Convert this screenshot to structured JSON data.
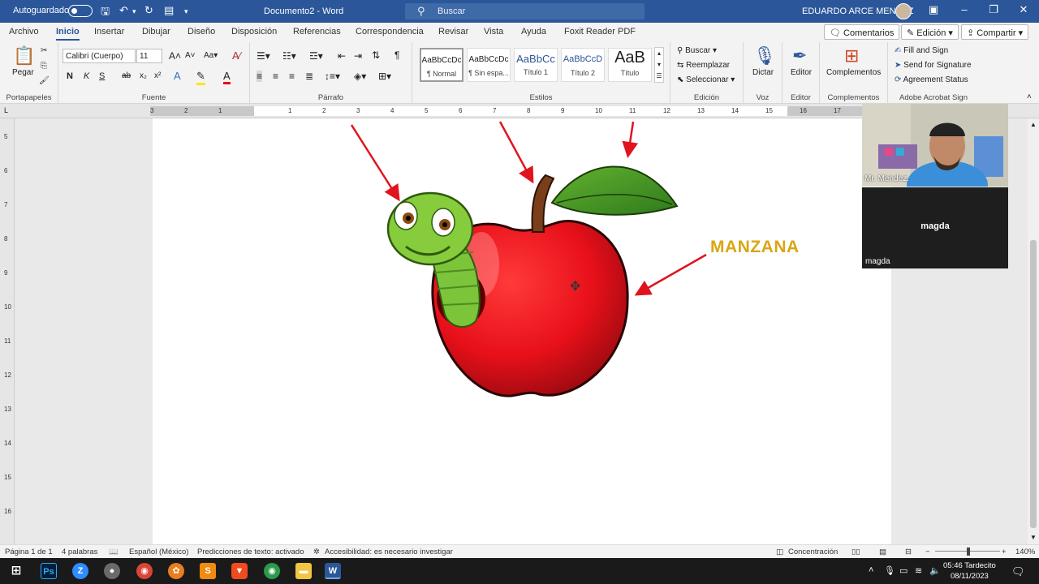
{
  "titlebar": {
    "autosave_label": "Autoguardado",
    "doc_title": "Documento2 - Word",
    "search_placeholder": "Buscar",
    "user_name": "EDUARDO ARCE MENDEZ"
  },
  "tabs": [
    "Archivo",
    "Inicio",
    "Insertar",
    "Dibujar",
    "Diseño",
    "Disposición",
    "Referencias",
    "Correspondencia",
    "Revisar",
    "Vista",
    "Ayuda",
    "Foxit Reader PDF"
  ],
  "top_buttons": {
    "comments": "Comentarios",
    "editing": "Edición",
    "share": "Compartir"
  },
  "ribbon": {
    "clipboard": {
      "paste": "Pegar",
      "label": "Portapapeles"
    },
    "font": {
      "name": "Calibri (Cuerpo)",
      "size": "11",
      "label": "Fuente",
      "bold": "N",
      "italic": "K",
      "underline": "S",
      "strike": "ab",
      "sub": "x₂",
      "sup": "x²"
    },
    "paragraph": {
      "label": "Párrafo"
    },
    "styles": {
      "label": "Estilos",
      "items": [
        {
          "preview": "AaBbCcDc",
          "name": "¶ Normal"
        },
        {
          "preview": "AaBbCcDc",
          "name": "¶ Sin espa..."
        },
        {
          "preview": "AaBbCc",
          "name": "Título 1"
        },
        {
          "preview": "AaBbCcD",
          "name": "Título 2"
        },
        {
          "preview": "AaB",
          "name": "Título"
        }
      ]
    },
    "editing": {
      "find": "Buscar",
      "replace": "Reemplazar",
      "select": "Seleccionar",
      "label": "Edición"
    },
    "voice": {
      "dictate": "Dictar",
      "label": "Voz"
    },
    "editor": {
      "name": "Editor",
      "label": "Editor"
    },
    "addins": {
      "name": "Complementos",
      "label": "Complementos"
    },
    "acrobat": {
      "fill": "Fill and Sign",
      "send": "Send for Signature",
      "status": "Agreement Status",
      "label": "Adobe Acrobat Sign"
    }
  },
  "ruler": {
    "numbers": [
      "3",
      "2",
      "1",
      "1",
      "2",
      "3",
      "4",
      "5",
      "6",
      "7",
      "8",
      "9",
      "10",
      "11",
      "12",
      "13",
      "14",
      "15",
      "16",
      "17"
    ]
  },
  "vruler": {
    "numbers": [
      "5",
      "6",
      "7",
      "8",
      "9",
      "10",
      "11",
      "12",
      "13",
      "14",
      "15",
      "16"
    ]
  },
  "document": {
    "label_manzana": "MANZANA"
  },
  "video": {
    "presenter_name": "Mr. Mendez.",
    "participant_center": "magda",
    "participant_name": "magda"
  },
  "statusbar": {
    "page": "Página 1 de 1",
    "words": "4 palabras",
    "language": "Español (México)",
    "predictions": "Predicciones de texto: activado",
    "accessibility": "Accesibilidad: es necesario investigar",
    "focus": "Concentración",
    "zoom": "140%"
  },
  "taskbar": {
    "time": "05:46 Tardecito",
    "date": "08/11/2023"
  },
  "colors": {
    "accent": "#2b579a",
    "apple": "#e8101a",
    "label": "#d9a614",
    "arrow": "#e0141e"
  }
}
